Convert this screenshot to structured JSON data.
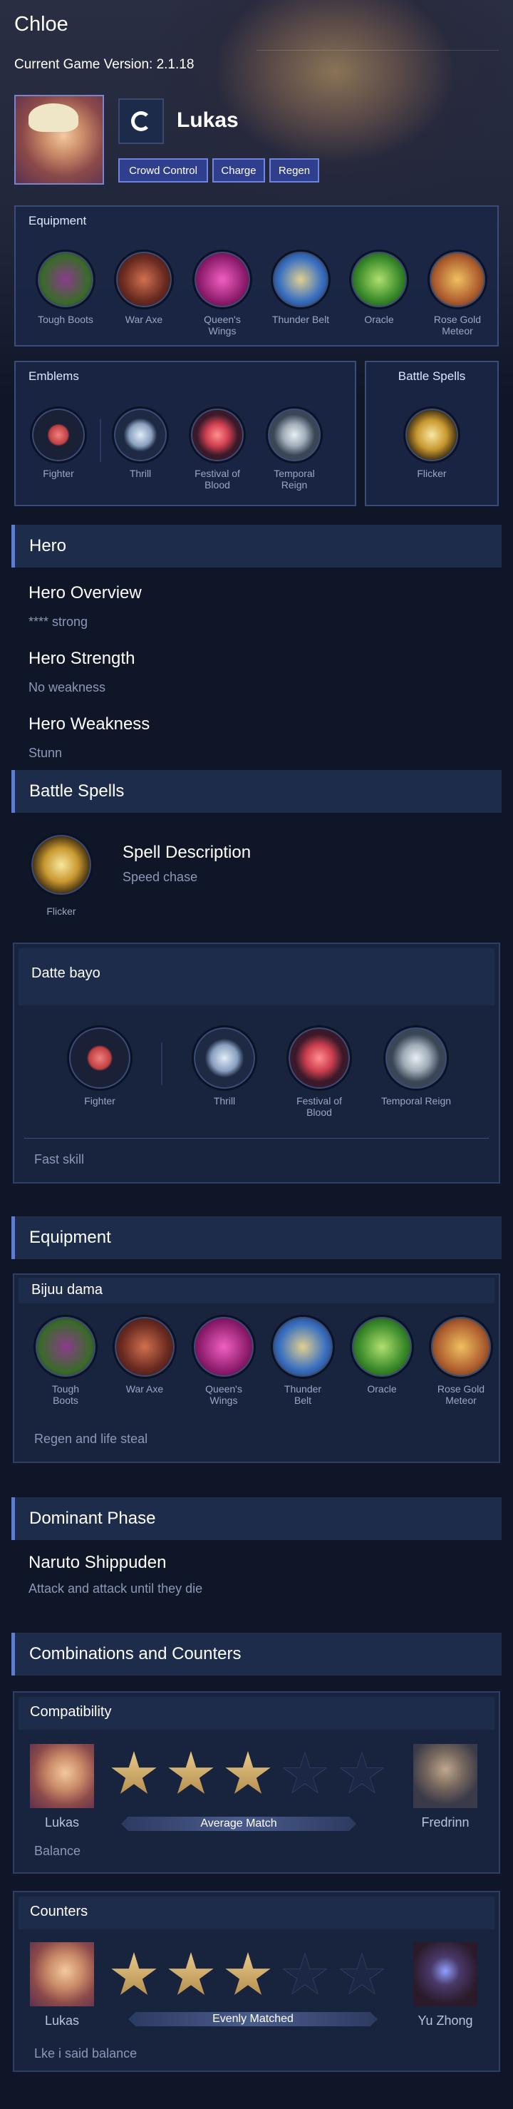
{
  "header": {
    "title": "Chloe",
    "version": "Current Game Version: 2.1.18"
  },
  "hero": {
    "name": "Lukas",
    "tags": [
      "Crowd Control",
      "Charge",
      "Regen"
    ]
  },
  "equipment_top": {
    "title": "Equipment",
    "items": [
      "Tough Boots",
      "War Axe",
      "Queen's Wings",
      "Thunder Belt",
      "Oracle",
      "Rose Gold Meteor"
    ]
  },
  "emblems": {
    "title": "Emblems",
    "main": "Fighter",
    "talents": [
      "Thrill",
      "Festival of Blood",
      "Temporal Reign"
    ]
  },
  "spells_top": {
    "title": "Battle Spells",
    "spell": "Flicker"
  },
  "hero_section": {
    "title": "Hero",
    "overview_title": "Hero Overview",
    "overview": "**** strong",
    "strength_title": "Hero Strength",
    "strength": "No weakness",
    "weakness_title": "Hero Weakness",
    "weakness": "Stunn"
  },
  "battle_spells": {
    "title": "Battle Spells",
    "spell": "Flicker",
    "desc_title": "Spell Description",
    "desc": "Speed chase"
  },
  "emblem_build": {
    "title": "Datte bayo",
    "main": "Fighter",
    "talents": [
      "Thrill",
      "Festival of Blood",
      "Temporal Reign"
    ],
    "note": "Fast skill"
  },
  "equipment": {
    "title": "Equipment",
    "build_name": "Bijuu dama",
    "items": [
      "Tough Boots",
      "War Axe",
      "Queen's Wings",
      "Thunder Belt",
      "Oracle",
      "Rose Gold Meteor"
    ],
    "note": "Regen and life steal"
  },
  "phase": {
    "title": "Dominant Phase",
    "name": "Naruto Shippuden",
    "desc": "Attack and attack until they die"
  },
  "combos": {
    "title": "Combinations and Counters",
    "compat": {
      "title": "Compatibility",
      "hero": "Lukas",
      "partner": "Fredrinn",
      "stars": 3,
      "max_stars": 5,
      "label": "Average Match",
      "note": "Balance"
    },
    "counters": {
      "title": "Counters",
      "hero": "Lukas",
      "enemy": "Yu Zhong",
      "stars": 3,
      "max_stars": 5,
      "label": "Evenly Matched",
      "note": "Lke i said balance"
    }
  },
  "colors": {
    "accent": "#5b7bd4",
    "background": "#0e1628",
    "tag": "#2f3f8e"
  }
}
